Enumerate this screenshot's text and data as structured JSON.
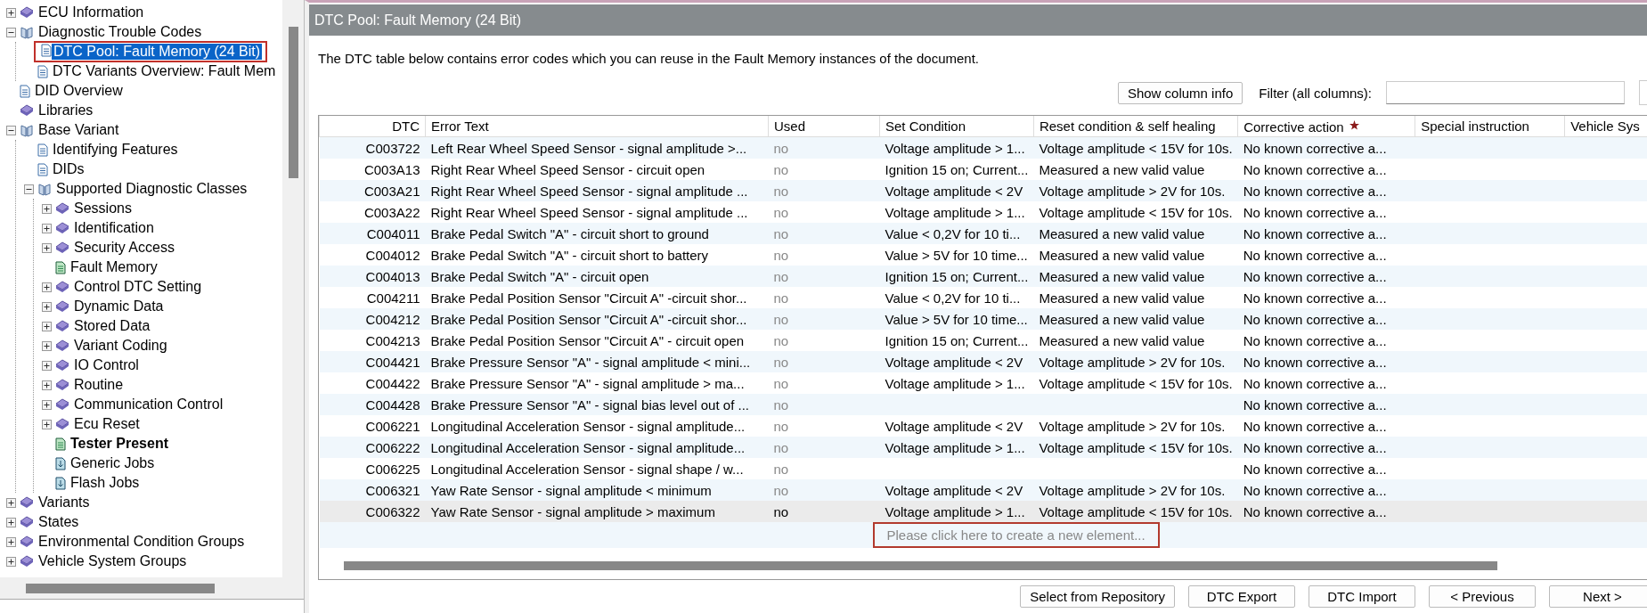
{
  "tree": [
    {
      "label": "ECU Information",
      "kind": "book",
      "expanded": false
    },
    {
      "label": "Diagnostic Trouble Codes",
      "kind": "open-book",
      "expanded": true,
      "children": [
        {
          "label": "DTC Pool: Fault Memory (24 Bit)",
          "kind": "doc",
          "selected": true,
          "highlighted": true
        },
        {
          "label": "DTC Variants Overview: Fault Mem",
          "kind": "doc",
          "selected": false
        }
      ]
    },
    {
      "label": "DID Overview",
      "kind": "doc",
      "selected": false
    },
    {
      "label": "Libraries",
      "kind": "book",
      "selected": false
    },
    {
      "label": "Base Variant",
      "kind": "open-book",
      "expanded": true,
      "children": [
        {
          "label": "Identifying Features",
          "kind": "doc",
          "selected": false
        },
        {
          "label": "DIDs",
          "kind": "doc",
          "selected": false
        },
        {
          "label": "Supported Diagnostic Classes",
          "kind": "open-book",
          "expanded": true,
          "children": [
            {
              "label": "Sessions",
              "kind": "book",
              "expanded": false
            },
            {
              "label": "Identification",
              "kind": "book",
              "expanded": false
            },
            {
              "label": "Security Access",
              "kind": "book",
              "expanded": false
            },
            {
              "label": "Fault Memory",
              "kind": "green-doc",
              "selected": false
            },
            {
              "label": "Control DTC Setting",
              "kind": "book",
              "expanded": false
            },
            {
              "label": "Dynamic Data",
              "kind": "book",
              "expanded": false
            },
            {
              "label": "Stored Data",
              "kind": "book",
              "expanded": false
            },
            {
              "label": "Variant Coding",
              "kind": "book",
              "expanded": false
            },
            {
              "label": "IO Control",
              "kind": "book",
              "expanded": false
            },
            {
              "label": "Routine",
              "kind": "book",
              "expanded": false
            },
            {
              "label": "Communication Control",
              "kind": "book",
              "expanded": false
            },
            {
              "label": "Ecu Reset",
              "kind": "book",
              "expanded": false
            },
            {
              "label": "Tester Present",
              "kind": "green-doc",
              "selected": false,
              "active": true
            },
            {
              "label": "Generic Jobs",
              "kind": "job-doc",
              "selected": false
            },
            {
              "label": "Flash Jobs",
              "kind": "job-doc",
              "selected": false
            }
          ]
        }
      ]
    },
    {
      "label": "Variants",
      "kind": "book",
      "expanded": false
    },
    {
      "label": "States",
      "kind": "book",
      "expanded": false
    },
    {
      "label": "Environmental Condition Groups",
      "kind": "book",
      "expanded": false
    },
    {
      "label": "Vehicle System Groups",
      "kind": "book",
      "expanded": false
    }
  ],
  "panel": {
    "title": "DTC Pool: Fault Memory (24 Bit)",
    "description": "The DTC table below contains error codes which you can reuse in the Fault Memory instances of the document.",
    "show_column_info_button": "Show column info",
    "filter_label": "Filter (all columns):"
  },
  "table": {
    "columns": [
      {
        "label": "DTC"
      },
      {
        "label": "Error Text"
      },
      {
        "label": "Used"
      },
      {
        "label": "Set Condition"
      },
      {
        "label": "Reset condition & self healing"
      },
      {
        "label": "Corrective action",
        "required": true
      },
      {
        "label": "Special instruction"
      },
      {
        "label": "Vehicle Sys"
      }
    ],
    "rows": [
      {
        "dtc": "C003722",
        "error_text": "Left Rear Wheel Speed Sensor - signal amplitude >...",
        "used": "no",
        "set_condition": "Voltage amplitude > 1...",
        "reset_condition": "Voltage amplitude < 15V for 10s.",
        "corrective_action": "No known corrective a...",
        "selected": false
      },
      {
        "dtc": "C003A13",
        "error_text": "Right Rear Wheel Speed Sensor - circuit open",
        "used": "no",
        "set_condition": "Ignition 15 on; Current...",
        "reset_condition": "Measured a new valid value",
        "corrective_action": "No known corrective a...",
        "selected": false
      },
      {
        "dtc": "C003A21",
        "error_text": "Right Rear Wheel Speed Sensor - signal amplitude ...",
        "used": "no",
        "set_condition": "Voltage amplitude < 2V",
        "reset_condition": "Voltage amplitude > 2V for 10s.",
        "corrective_action": "No known corrective a...",
        "selected": false
      },
      {
        "dtc": "C003A22",
        "error_text": "Right Rear Wheel Speed Sensor - signal amplitude ...",
        "used": "no",
        "set_condition": "Voltage amplitude > 1...",
        "reset_condition": "Voltage amplitude < 15V for 10s.",
        "corrective_action": "No known corrective a...",
        "selected": false
      },
      {
        "dtc": "C004011",
        "error_text": "Brake Pedal Switch \"A\" - circuit short to ground",
        "used": "no",
        "set_condition": "Value < 0,2V for 10 ti...",
        "reset_condition": "Measured a new valid value",
        "corrective_action": "No known corrective a...",
        "selected": false
      },
      {
        "dtc": "C004012",
        "error_text": "Brake Pedal Switch \"A\" - circuit short to battery",
        "used": "no",
        "set_condition": "Value > 5V for 10 time...",
        "reset_condition": "Measured a new valid value",
        "corrective_action": "No known corrective a...",
        "selected": false
      },
      {
        "dtc": "C004013",
        "error_text": "Brake Pedal Switch \"A\" - circuit open",
        "used": "no",
        "set_condition": "Ignition 15 on; Current...",
        "reset_condition": "Measured a new valid value",
        "corrective_action": "No known corrective a...",
        "selected": false
      },
      {
        "dtc": "C004211",
        "error_text": "Brake Pedal Position Sensor \"Circuit A\" -circuit shor...",
        "used": "no",
        "set_condition": "Value < 0,2V for 10 ti...",
        "reset_condition": "Measured a new valid value",
        "corrective_action": "No known corrective a...",
        "selected": false
      },
      {
        "dtc": "C004212",
        "error_text": "Brake Pedal Position Sensor \"Circuit A\" -circuit shor...",
        "used": "no",
        "set_condition": "Value > 5V for 10 time...",
        "reset_condition": "Measured a new valid value",
        "corrective_action": "No known corrective a...",
        "selected": false
      },
      {
        "dtc": "C004213",
        "error_text": "Brake Pedal Position Sensor \"Circuit A\" - circuit open",
        "used": "no",
        "set_condition": "Ignition 15 on; Current...",
        "reset_condition": "Measured a new valid value",
        "corrective_action": "No known corrective a...",
        "selected": false
      },
      {
        "dtc": "C004421",
        "error_text": "Brake Pressure Sensor \"A\" - signal amplitude < mini...",
        "used": "no",
        "set_condition": "Voltage amplitude < 2V",
        "reset_condition": "Voltage amplitude > 2V for 10s.",
        "corrective_action": "No known corrective a...",
        "selected": false
      },
      {
        "dtc": "C004422",
        "error_text": "Brake Pressure Sensor \"A\" - signal amplitude > ma...",
        "used": "no",
        "set_condition": "Voltage amplitude > 1...",
        "reset_condition": "Voltage amplitude < 15V for 10s.",
        "corrective_action": "No known corrective a...",
        "selected": false
      },
      {
        "dtc": "C004428",
        "error_text": "Brake Pressure Sensor \"A\" - signal bias level out of ...",
        "used": "no",
        "corrective_action": "No known corrective a...",
        "selected": false
      },
      {
        "dtc": "C006221",
        "error_text": "Longitudinal Acceleration Sensor - signal amplitude...",
        "used": "no",
        "set_condition": "Voltage amplitude < 2V",
        "reset_condition": "Voltage amplitude > 2V for 10s.",
        "corrective_action": "No known corrective a...",
        "selected": false
      },
      {
        "dtc": "C006222",
        "error_text": "Longitudinal Acceleration Sensor - signal amplitude...",
        "used": "no",
        "set_condition": "Voltage amplitude > 1...",
        "reset_condition": "Voltage amplitude < 15V for 10s.",
        "corrective_action": "No known corrective a...",
        "selected": false
      },
      {
        "dtc": "C006225",
        "error_text": "Longitudinal Acceleration Sensor - signal shape / w...",
        "used": "no",
        "corrective_action": "No known corrective a...",
        "selected": false
      },
      {
        "dtc": "C006321",
        "error_text": "Yaw Rate Sensor - signal amplitude < minimum",
        "used": "no",
        "set_condition": "Voltage amplitude < 2V",
        "reset_condition": "Voltage amplitude > 2V for 10s.",
        "corrective_action": "No known corrective a...",
        "selected": false
      },
      {
        "dtc": "C006322",
        "error_text": "Yaw Rate Sensor - signal amplitude > maximum",
        "used": "no",
        "set_condition": "Voltage amplitude > 1...",
        "reset_condition": "Voltage amplitude < 15V for 10s.",
        "corrective_action": "No known corrective a...",
        "selected": true
      }
    ],
    "create_prompt": {
      "text": "Please click here to create a new element...",
      "highlighted": true
    }
  },
  "buttons": [
    "Select from Repository",
    "DTC Export",
    "DTC Import",
    "< Previous",
    "Next >"
  ]
}
